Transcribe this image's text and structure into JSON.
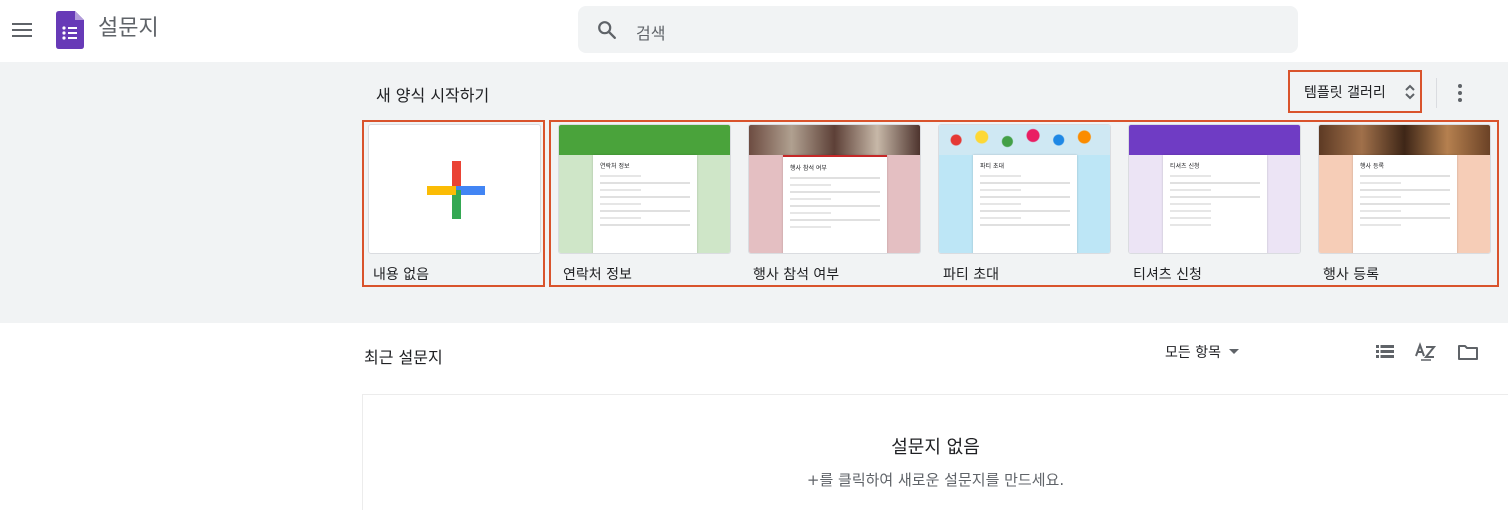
{
  "header": {
    "app_title": "설문지",
    "search_placeholder": "검색",
    "menu_icon": "hamburger-menu-icon",
    "logo_icon": "forms-logo-icon"
  },
  "templates": {
    "section_title": "새 양식 시작하기",
    "gallery_label": "템플릿 갤러리",
    "blank_label": "내용 없음",
    "items": [
      {
        "label": "연락처 정보",
        "color": "#4aa33b",
        "bg": "#cfe6c8",
        "form_title": "연락처 정보"
      },
      {
        "label": "행사 참석 여부",
        "color": "#8a6b5a",
        "bg": "#e4bfc2",
        "form_title": "행사 참석 여부"
      },
      {
        "label": "파티 초대",
        "color": "#e0c24a",
        "bg": "#bde6f6",
        "form_title": "파티 초대"
      },
      {
        "label": "티셔츠 신청",
        "color": "#6f3cc4",
        "bg": "#ece4f5",
        "form_title": "티셔츠 신청"
      },
      {
        "label": "행사 등록",
        "color": "#8c5a3c",
        "bg": "#f6cdb7",
        "form_title": "행사 등록"
      }
    ]
  },
  "recent": {
    "title": "최근 설문지",
    "filter_label": "모든 항목",
    "empty_title": "설문지 없음",
    "empty_subtitle": "+를 클릭하여 새로운 설문지를 만드세요."
  },
  "colors": {
    "accent_frame": "#d9532c",
    "forms_purple": "#673ab7"
  }
}
